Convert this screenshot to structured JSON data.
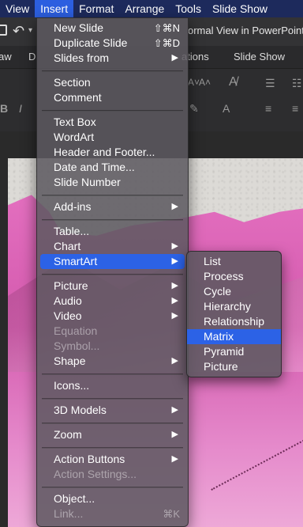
{
  "menubar": {
    "items": [
      {
        "label": "View"
      },
      {
        "label": "Insert"
      },
      {
        "label": "Format"
      },
      {
        "label": "Arrange"
      },
      {
        "label": "Tools"
      },
      {
        "label": "Slide Show"
      }
    ]
  },
  "window": {
    "title_fragment": "ormal View in PowerPoint"
  },
  "ribbon": {
    "tab_fragments": [
      "aw",
      "D",
      "ations",
      "Slide Show"
    ]
  },
  "insert_menu": {
    "items": [
      {
        "label": "New Slide",
        "shortcut": "⇧⌘N"
      },
      {
        "label": "Duplicate Slide",
        "shortcut": "⇧⌘D"
      },
      {
        "label": "Slides from"
      },
      {
        "label": "Section"
      },
      {
        "label": "Comment"
      },
      {
        "label": "Text Box"
      },
      {
        "label": "WordArt"
      },
      {
        "label": "Header and Footer..."
      },
      {
        "label": "Date and Time..."
      },
      {
        "label": "Slide Number"
      },
      {
        "label": "Add-ins"
      },
      {
        "label": "Table..."
      },
      {
        "label": "Chart"
      },
      {
        "label": "SmartArt"
      },
      {
        "label": "Picture"
      },
      {
        "label": "Audio"
      },
      {
        "label": "Video"
      },
      {
        "label": "Equation"
      },
      {
        "label": "Symbol..."
      },
      {
        "label": "Shape"
      },
      {
        "label": "Icons..."
      },
      {
        "label": "3D Models"
      },
      {
        "label": "Zoom"
      },
      {
        "label": "Action Buttons"
      },
      {
        "label": "Action Settings..."
      },
      {
        "label": "Object..."
      },
      {
        "label": "Link...",
        "shortcut": "⌘K"
      }
    ]
  },
  "smartart_submenu": {
    "items": [
      {
        "label": "List"
      },
      {
        "label": "Process"
      },
      {
        "label": "Cycle"
      },
      {
        "label": "Hierarchy"
      },
      {
        "label": "Relationship"
      },
      {
        "label": "Matrix"
      },
      {
        "label": "Pyramid"
      },
      {
        "label": "Picture"
      }
    ],
    "selected": "Matrix"
  },
  "colors": {
    "menubar_bg": "#1d2a5c",
    "accent": "#2c62e6",
    "slide_art": "#e36fbf"
  }
}
